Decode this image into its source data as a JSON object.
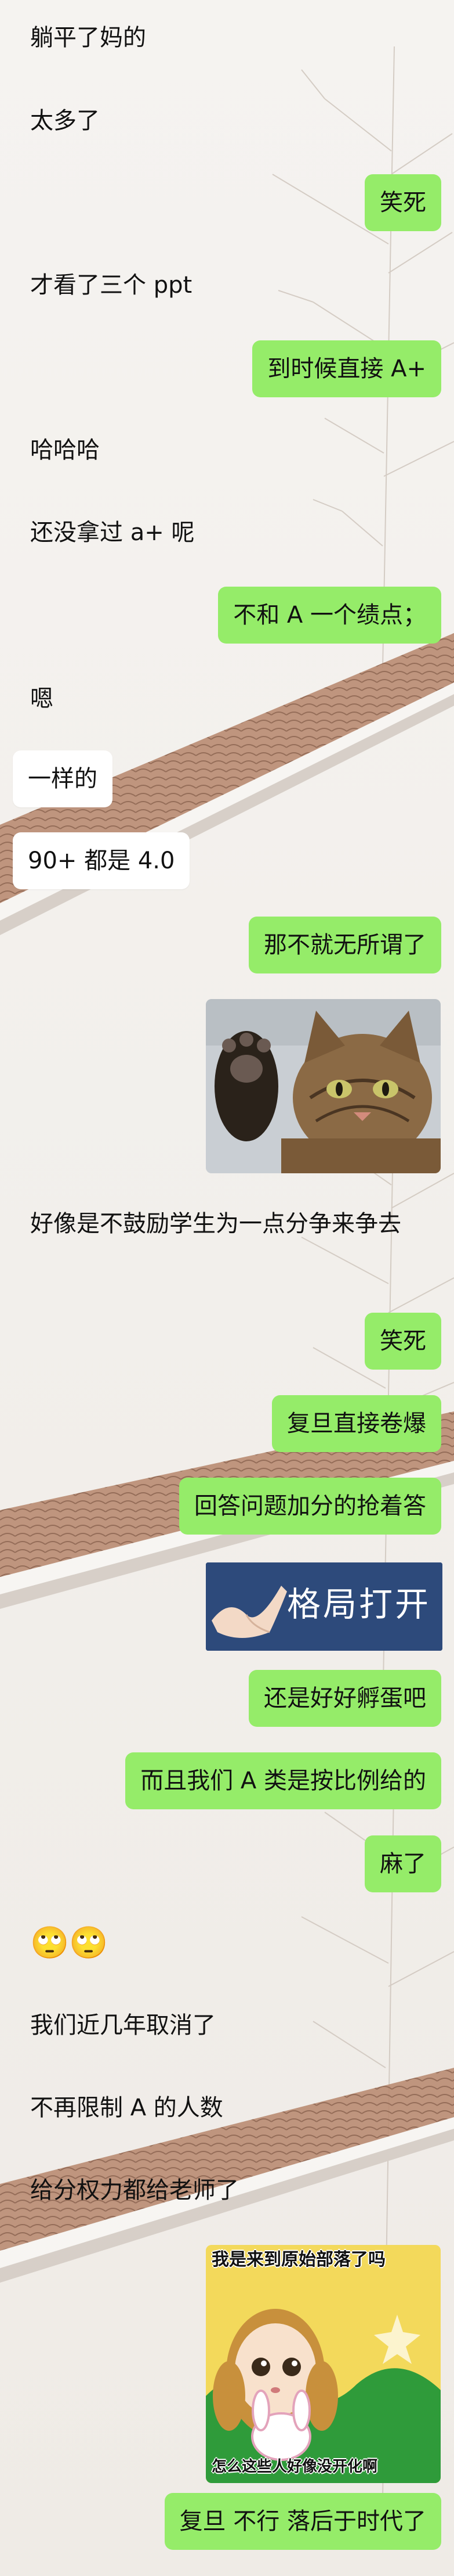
{
  "messages": [
    {
      "id": "m1",
      "side": "left",
      "style": "plain",
      "text": "躺平了妈的"
    },
    {
      "id": "m2",
      "side": "left",
      "style": "plain",
      "text": "太多了"
    },
    {
      "id": "m3",
      "side": "right",
      "style": "green",
      "text": "笑死"
    },
    {
      "id": "m4",
      "side": "left",
      "style": "plain",
      "text": "才看了三个 ppt"
    },
    {
      "id": "m5",
      "side": "right",
      "style": "green",
      "text": "到时候直接 A+"
    },
    {
      "id": "m6",
      "side": "left",
      "style": "plain",
      "text": "哈哈哈"
    },
    {
      "id": "m7",
      "side": "left",
      "style": "plain",
      "text": "还没拿过 a+ 呢"
    },
    {
      "id": "m8",
      "side": "right",
      "style": "green",
      "text": "不和 A 一个绩点；"
    },
    {
      "id": "m9",
      "side": "left",
      "style": "plain",
      "text": "嗯"
    },
    {
      "id": "m10",
      "side": "left",
      "style": "white",
      "text": "一样的"
    },
    {
      "id": "m11",
      "side": "left",
      "style": "white",
      "text": "90+ 都是 4.0"
    },
    {
      "id": "m12",
      "side": "right",
      "style": "green",
      "text": "那不就无所谓了"
    },
    {
      "id": "m13",
      "side": "left",
      "style": "plain",
      "text": "好像是不鼓励学生为一点分争来争去"
    },
    {
      "id": "m14",
      "side": "right",
      "style": "green",
      "text": "笑死"
    },
    {
      "id": "m15",
      "side": "right",
      "style": "green",
      "text": "复旦直接卷爆"
    },
    {
      "id": "m16",
      "side": "right",
      "style": "green",
      "text": "回答问题加分的抢着答"
    },
    {
      "id": "m17",
      "side": "right",
      "style": "green",
      "text": "还是好好孵蛋吧"
    },
    {
      "id": "m18",
      "side": "right",
      "style": "green",
      "text": "而且我们 A 类是按比例给的"
    },
    {
      "id": "m19",
      "side": "right",
      "style": "green",
      "text": "麻了"
    },
    {
      "id": "m20",
      "side": "left",
      "style": "plain",
      "text": "🙄🙄"
    },
    {
      "id": "m21",
      "side": "left",
      "style": "plain",
      "text": "我们近几年取消了"
    },
    {
      "id": "m22",
      "side": "left",
      "style": "plain",
      "text": "不再限制 A 的人数"
    },
    {
      "id": "m23",
      "side": "left",
      "style": "plain",
      "text": "给分权力都给老师了"
    },
    {
      "id": "m24",
      "side": "right",
      "style": "green",
      "text": "复旦 不行 落后于时代了"
    }
  ],
  "stickers": {
    "cat": {
      "icon": "cat-salute-sticker"
    },
    "geju": {
      "text": "格局打开",
      "icon": "hand-gesture-icon"
    },
    "anime": {
      "top_text": "我是来到原始部落了吗",
      "bottom_text": "怎么这些人好像没开化啊"
    }
  }
}
